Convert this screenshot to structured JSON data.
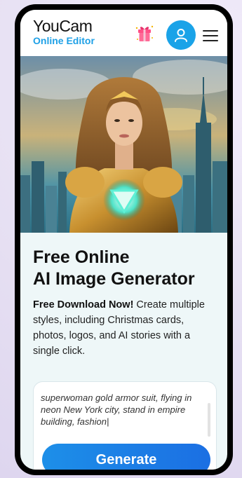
{
  "header": {
    "logo_line1": "YouCam",
    "logo_line2": "Online Editor",
    "gift_icon": "gift-icon",
    "user_icon": "user-icon",
    "menu_icon": "hamburger-menu-icon"
  },
  "hero": {
    "image_description_icon": "hero-image"
  },
  "content": {
    "title_line1": "Free Online",
    "title_line2": "AI Image Generator",
    "desc_bold": "Free Download Now!",
    "desc_rest": " Create multiple styles, including Christmas cards, photos, logos, and AI stories with a single click."
  },
  "prompt": {
    "text": "superwoman gold armor suit, flying in neon New York city, stand in empire building, fashion|",
    "button_label": "Generate"
  },
  "colors": {
    "accent": "#1aa3e8",
    "button": "#1b7fe6",
    "background": "#eef7f8"
  }
}
